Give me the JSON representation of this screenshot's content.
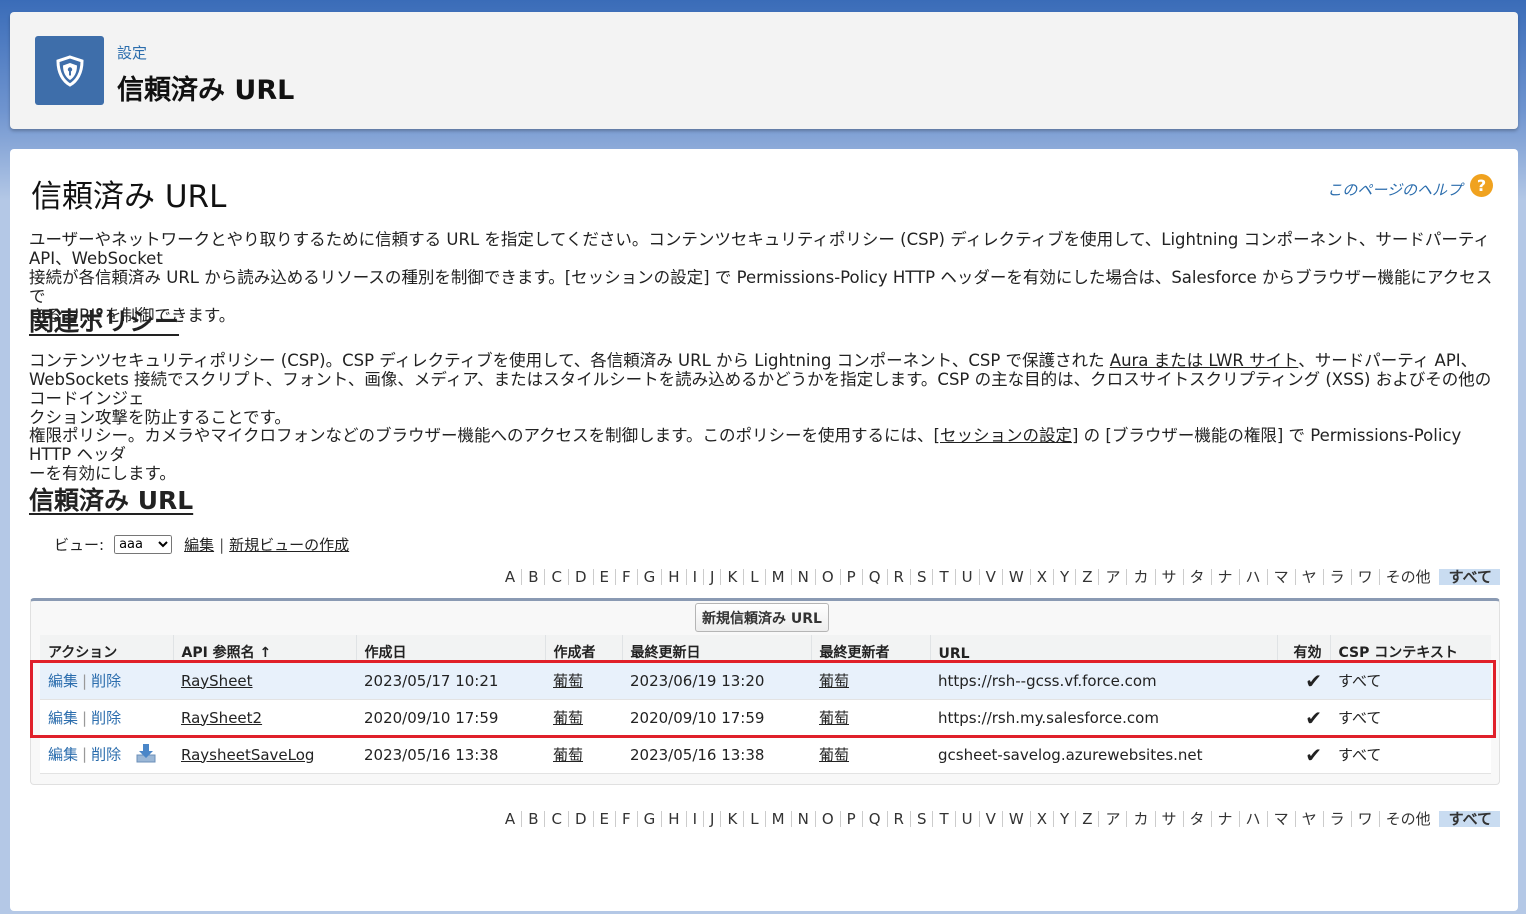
{
  "header": {
    "eyebrow": "設定",
    "title": "信頼済み URL",
    "icon": "shield-icon"
  },
  "page": {
    "title": "信頼済み URL",
    "help_link": "このページのヘルプ",
    "help_icon": "?",
    "intro_line1": "ユーザーやネットワークとやり取りするために信頼する URL を指定してください。コンテンツセキュリティポリシー (CSP) ディレクティブを使用して、Lightning コンポーネント、サードパーティ API、WebSocket",
    "intro_line2": "接続が各信頼済み URL から読み込めるリソースの種別を制御できます。[セッションの設定] で Permissions-Policy HTTP ヘッダーを有効にした場合は、Salesforce からブラウザー機能にアクセスで",
    "intro_line3": "きる URL を制御できます。"
  },
  "related": {
    "heading": "関連ポリシー",
    "csp_line1_a": "コンテンツセキュリティポリシー (CSP)。CSP ディレクティブを使用して、各信頼済み URL から Lightning コンポーネント、CSP で保護された ",
    "csp_link": "Aura または LWR サイト",
    "csp_line1_b": "、サードパーティ API、",
    "csp_line2": "WebSockets 接続でスクリプト、フォント、画像、メディア、またはスタイルシートを読み込めるかどうかを指定します。CSP の主な目的は、クロスサイトスクリプティング (XSS) およびその他のコードインジェ",
    "csp_line3": "クション攻撃を防止することです。",
    "perm_line1_a": "権限ポリシー。カメラやマイクロフォンなどのブラウザー機能へのアクセスを制御します。このポリシーを使用するには、",
    "perm_link": "[セッションの設定]",
    "perm_line1_b": " の [ブラウザー機能の権限] で Permissions-Policy HTTP ヘッダ",
    "perm_line2": "ーを有効にします。"
  },
  "list": {
    "heading": "信頼済み URL",
    "view_label": "ビュー:",
    "view_selected": "aaa",
    "edit_link": "編集",
    "new_view_link": "新規ビューの作成",
    "alphabet": [
      "A",
      "B",
      "C",
      "D",
      "E",
      "F",
      "G",
      "H",
      "I",
      "J",
      "K",
      "L",
      "M",
      "N",
      "O",
      "P",
      "Q",
      "R",
      "S",
      "T",
      "U",
      "V",
      "W",
      "X",
      "Y",
      "Z",
      "ア",
      "カ",
      "サ",
      "タ",
      "ナ",
      "ハ",
      "マ",
      "ヤ",
      "ラ",
      "ワ",
      "その他"
    ],
    "alphabet_all": "すべて",
    "new_button": "新規信頼済み URL",
    "columns": [
      "アクション",
      "API 参照名 ↑",
      "作成日",
      "作成者",
      "最終更新日",
      "最終更新者",
      "URL",
      "有効",
      "CSP コンテキスト"
    ],
    "action_edit": "編集",
    "action_delete": "削除",
    "rows": [
      {
        "name": "RaySheet",
        "created": "2023/05/17 10:21",
        "creator": "葡萄",
        "modified": "2023/06/19 13:20",
        "modifier": "葡萄",
        "url": "https://rsh--gcss.vf.force.com",
        "active": "✔",
        "csp": "すべて"
      },
      {
        "name": "RaySheet2",
        "created": "2020/09/10 17:59",
        "creator": "葡萄",
        "modified": "2020/09/10 17:59",
        "modifier": "葡萄",
        "url": "https://rsh.my.salesforce.com",
        "active": "✔",
        "csp": "すべて"
      },
      {
        "name": "RaysheetSaveLog",
        "created": "2023/05/16 13:38",
        "creator": "葡萄",
        "modified": "2023/05/16 13:38",
        "modifier": "葡萄",
        "url": "gcsheet-savelog.azurewebsites.net",
        "active": "✔",
        "csp": "すべて"
      }
    ]
  },
  "colors": {
    "accent": "#2b6dad",
    "header_icon_bg": "#3e6eaa",
    "highlight_border": "#e0202a"
  }
}
